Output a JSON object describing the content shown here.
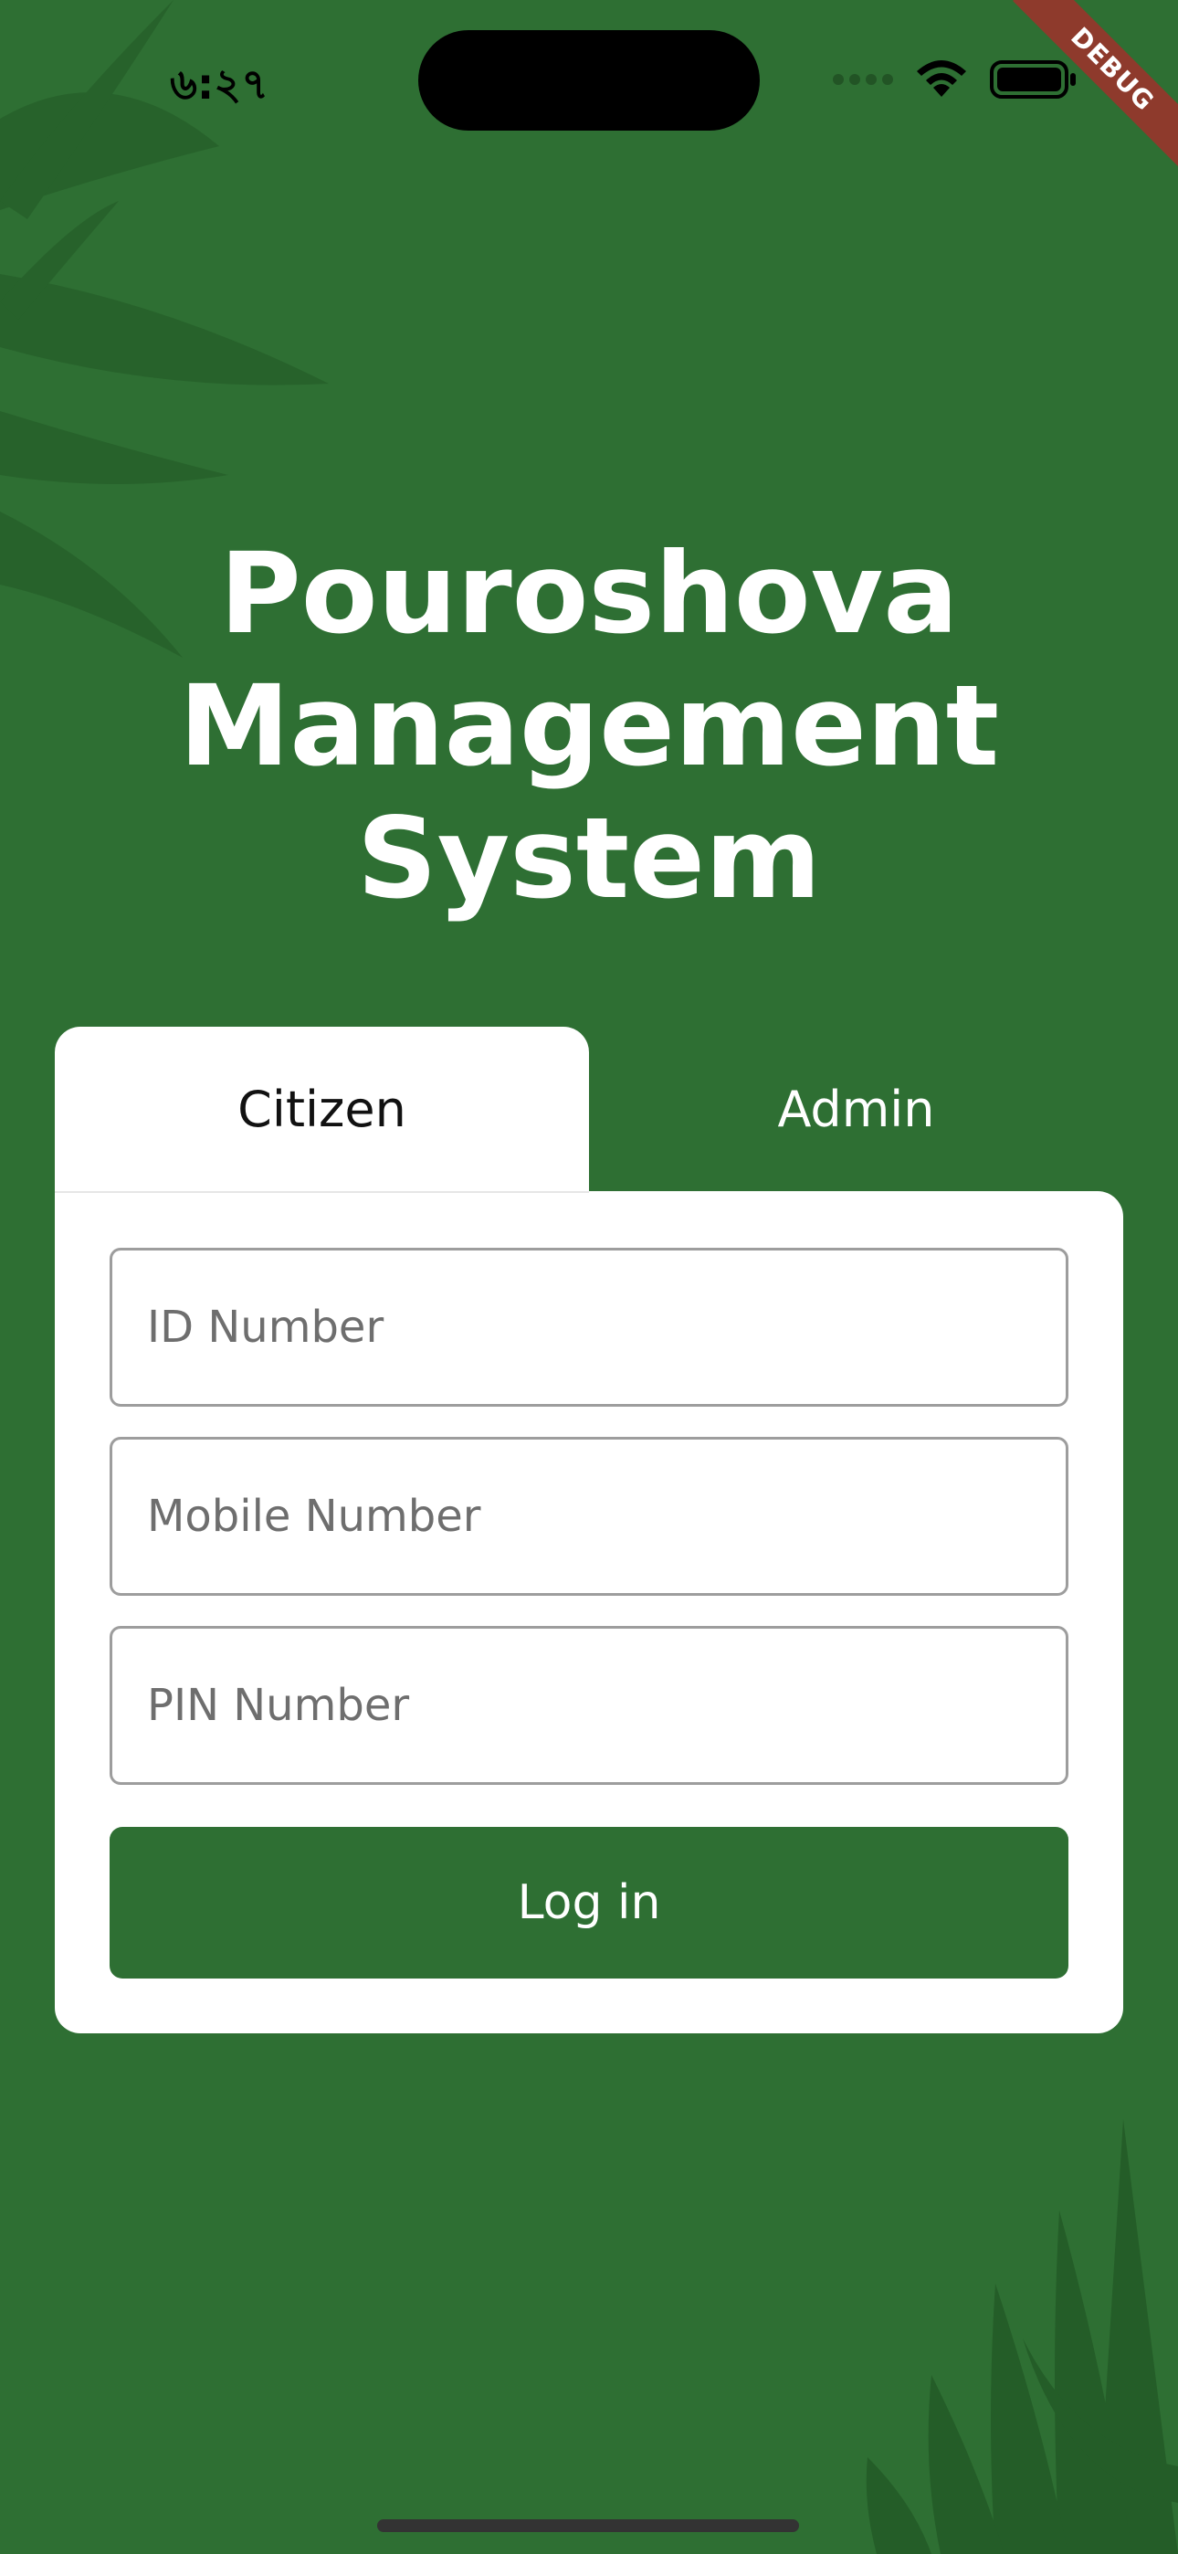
{
  "status_bar": {
    "time": "৬:২৭",
    "debug_banner": "DEBUG",
    "icons": [
      "signal-dots-icon",
      "wifi-icon",
      "battery-icon"
    ]
  },
  "app": {
    "title_lines": [
      "Pouroshova",
      "Management",
      "System"
    ]
  },
  "tabs": {
    "citizen": "Citizen",
    "admin": "Admin",
    "selected": "Citizen"
  },
  "form": {
    "id_placeholder": "ID Number",
    "mobile_placeholder": "Mobile Number",
    "pin_placeholder": "PIN Number",
    "id_value": "",
    "mobile_value": "",
    "pin_value": "",
    "login_label": "Log in"
  },
  "colors": {
    "background": "#2e6f33",
    "card": "#ffffff",
    "button": "#2e6f33",
    "debug_ribbon": "#8e3a2c"
  }
}
